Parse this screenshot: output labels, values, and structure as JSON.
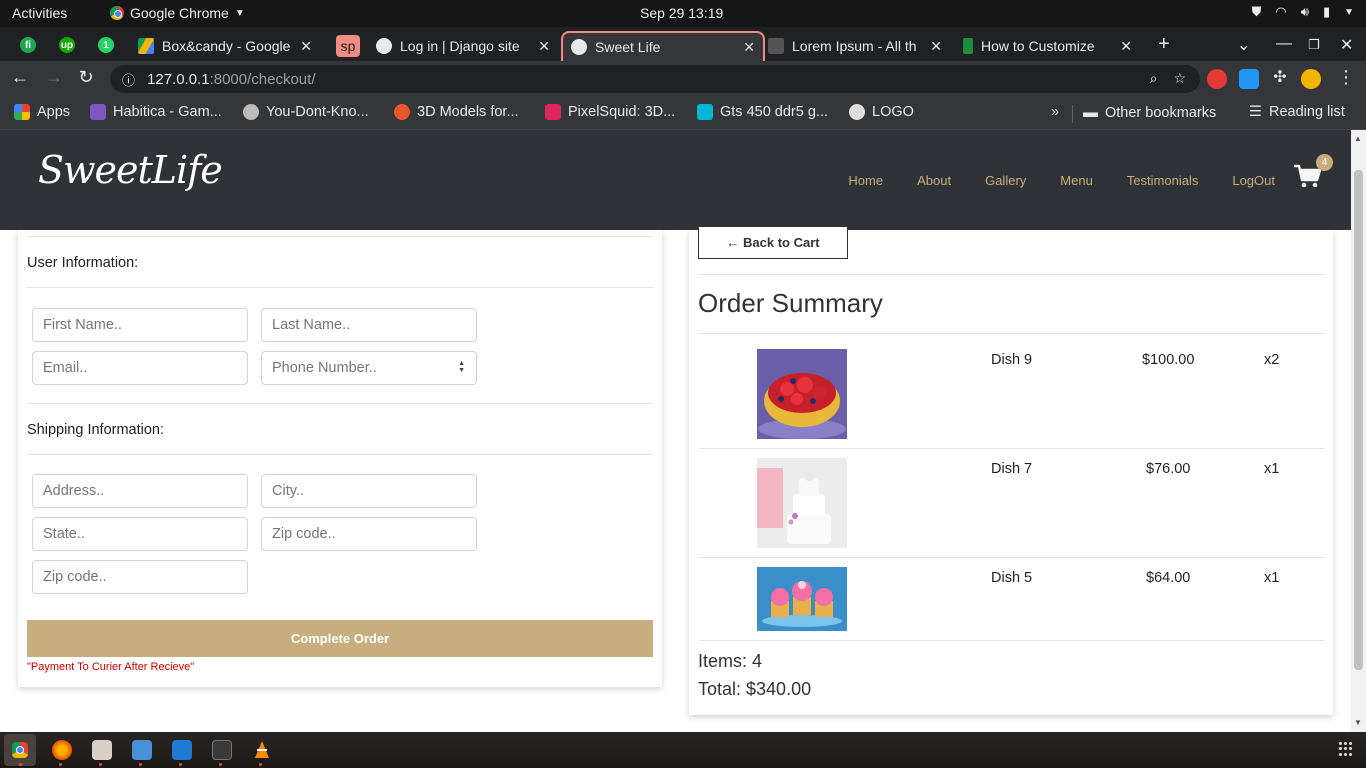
{
  "system": {
    "activities": "Activities",
    "app_name": "Google Chrome",
    "clock": "Sep 29  13:19"
  },
  "tabs": [
    {
      "title": "Box&candy - Google",
      "icon": "google-drive-icon"
    },
    {
      "title": "Log in | Django site",
      "icon": "globe-icon"
    },
    {
      "title": "Sweet Life",
      "icon": "globe-icon",
      "active": true
    },
    {
      "title": "Lorem Ipsum - All th",
      "icon": "lorem-icon"
    },
    {
      "title": "How to Customize",
      "icon": "bookmark-icon"
    }
  ],
  "pinned_tabs": [
    {
      "label": "fi",
      "color": "#1da851"
    },
    {
      "label": "up",
      "color": "#14a800"
    },
    {
      "label": "1",
      "color": "#25d366"
    }
  ],
  "special_tab_label": "sp",
  "address": {
    "host": "127.0.0.1",
    "path": ":8000/checkout/"
  },
  "bookmarks": [
    {
      "label": "Apps",
      "color": "#ea4335"
    },
    {
      "label": "Habitica - Gam...",
      "color": "#7e57c2"
    },
    {
      "label": "You-Dont-Kno...",
      "color": "#bbbbbb"
    },
    {
      "label": "3D Models for...",
      "color": "#e8572a"
    },
    {
      "label": "PixelSquid: 3D...",
      "color": "#e0245e"
    },
    {
      "label": "Gts 450 ddr5 g...",
      "color": "#00b8d4"
    },
    {
      "label": "LOGO",
      "color": "#dddddd"
    }
  ],
  "bookmarks_right": {
    "overflow": "»",
    "other": "Other bookmarks",
    "reading": "Reading list"
  },
  "site": {
    "logo": "SweetLife",
    "nav": [
      "Home",
      "About",
      "Gallery",
      "Menu",
      "Testimonials",
      "LogOut"
    ],
    "cart_count": "4"
  },
  "form": {
    "user_section": "User Information:",
    "shipping_section": "Shipping Information:",
    "first_name": "First Name..",
    "last_name": "Last Name..",
    "email": "Email..",
    "phone": "Phone Number..",
    "address": "Address..",
    "city": "City..",
    "state": "State..",
    "zip": "Zip code..",
    "zip2": "Zip code..",
    "submit": "Complete Order",
    "note": "\"Payment To Curier After Recieve\""
  },
  "summary": {
    "back": "← Back to Cart",
    "title": "Order Summary",
    "items": [
      {
        "name": "Dish 9",
        "price": "$100.00",
        "qty": "x2"
      },
      {
        "name": "Dish 7",
        "price": "$76.00",
        "qty": "x1"
      },
      {
        "name": "Dish 5",
        "price": "$64.00",
        "qty": "x1"
      }
    ],
    "items_total": "Items: 4",
    "total": "Total: $340.00"
  },
  "colors": {
    "accent": "#c8ad7f",
    "header_bg": "#2f3237",
    "note_red": "#cc0000"
  }
}
